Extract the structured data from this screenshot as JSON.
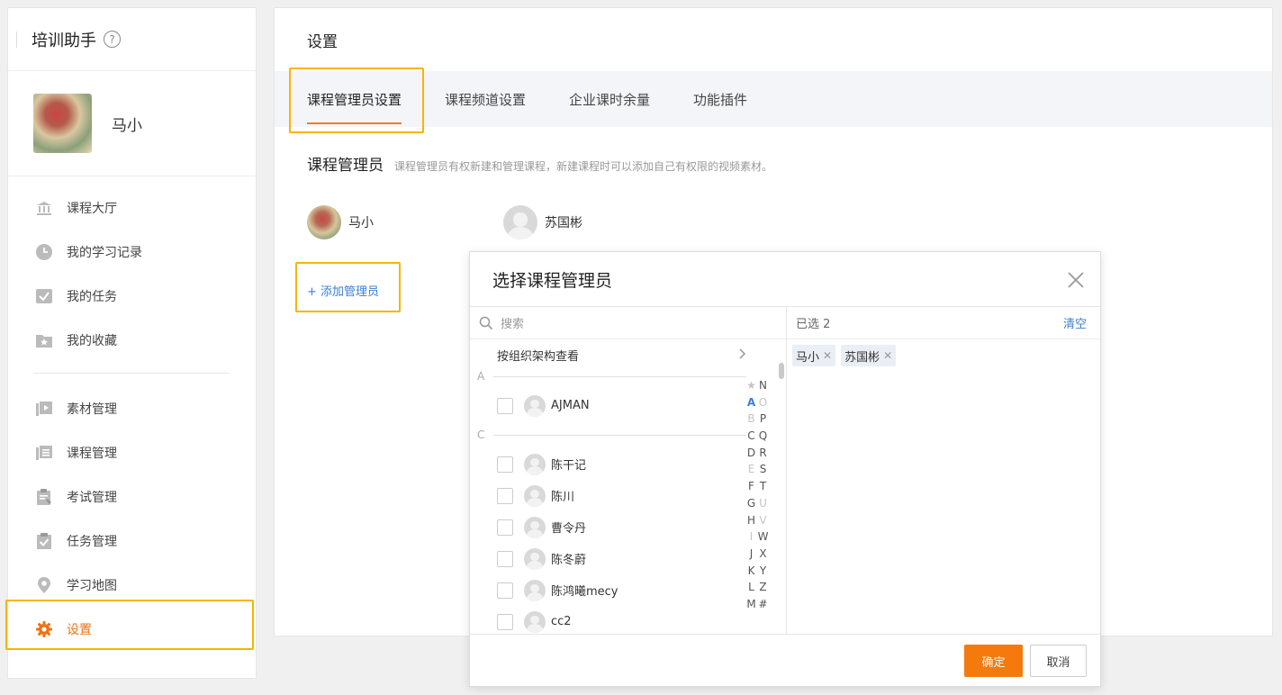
{
  "sidebar": {
    "title": "培训助手",
    "help_glyph": "?",
    "user_name": "马小",
    "items": [
      {
        "label": "课程大厅",
        "icon": "bank-icon"
      },
      {
        "label": "我的学习记录",
        "icon": "clock-icon"
      },
      {
        "label": "我的任务",
        "icon": "checkbox-icon"
      },
      {
        "label": "我的收藏",
        "icon": "star-folder-icon"
      },
      {
        "label": "素材管理",
        "icon": "video-icon"
      },
      {
        "label": "课程管理",
        "icon": "course-list-icon"
      },
      {
        "label": "考试管理",
        "icon": "exam-clipboard-icon"
      },
      {
        "label": "任务管理",
        "icon": "task-clipboard-icon"
      },
      {
        "label": "学习地图",
        "icon": "map-pin-icon"
      },
      {
        "label": "设置",
        "icon": "gear-icon"
      }
    ]
  },
  "main": {
    "title": "设置",
    "tabs": [
      "课程管理员设置",
      "课程频道设置",
      "企业课时余量",
      "功能插件"
    ],
    "section_title": "课程管理员",
    "section_desc": "课程管理员有权新建和管理课程，新建课程时可以添加自己有权限的视频素材。",
    "admins": [
      "马小",
      "苏国彬"
    ],
    "add_admin": "+ 添加管理员"
  },
  "modal": {
    "title": "选择课程管理员",
    "search_placeholder": "搜索",
    "org_view": "按组织架构查看",
    "letter_a": "A",
    "letter_c": "C",
    "people_a": [
      "AJMAN"
    ],
    "people_c": [
      "陈干记",
      "陈川",
      "曹令丹",
      "陈冬蔚",
      "陈鸿曦mecy",
      "cc2"
    ],
    "selected_label": "已选 2",
    "clear": "清空",
    "selected": [
      "马小",
      "苏国彬"
    ],
    "index_left": [
      "★",
      "A",
      "B",
      "C",
      "D",
      "E",
      "F",
      "G",
      "H",
      "I",
      "J",
      "K",
      "L",
      "M"
    ],
    "index_right": [
      "N",
      "O",
      "P",
      "Q",
      "R",
      "S",
      "T",
      "U",
      "V",
      "W",
      "X",
      "Y",
      "Z",
      "#"
    ],
    "ok": "确定",
    "cancel": "取消"
  },
  "colors": {
    "accent": "#f07010",
    "highlight": "#f7b500",
    "link": "#3a7fd5"
  }
}
